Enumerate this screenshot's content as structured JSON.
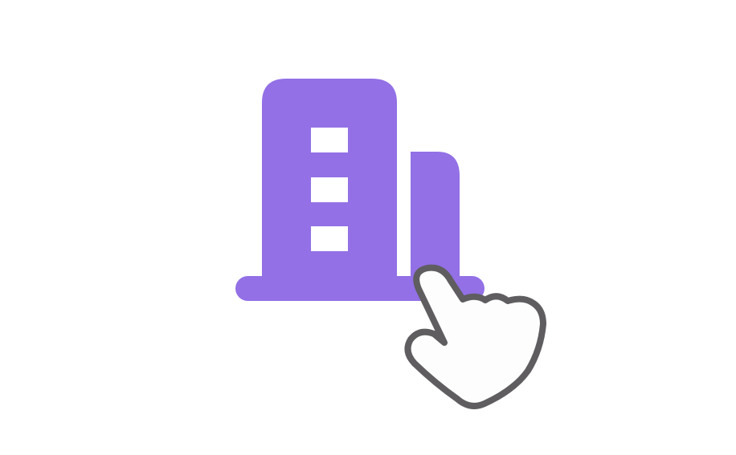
{
  "canvas": {
    "background": "#ffffff"
  },
  "building_icon": {
    "icon": "office-building-icon",
    "color": "#9370e6",
    "window_color": "#ffffff",
    "window_count": 3
  },
  "hand_cursor": {
    "icon": "pointing-hand-cursor-icon",
    "fill": "#fdfdfd",
    "stroke": "#5f5d60"
  }
}
